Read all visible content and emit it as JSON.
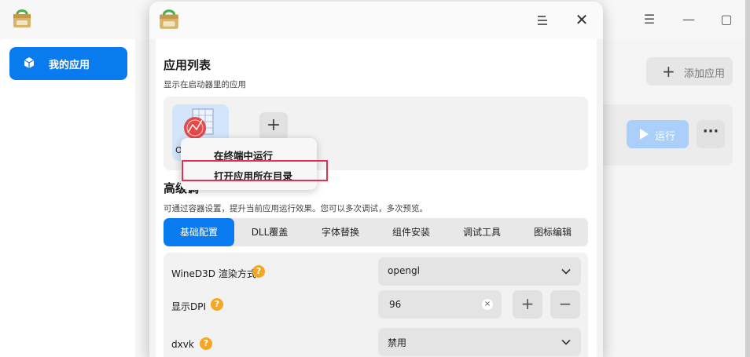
{
  "main_window": {
    "sidebar": {
      "items": [
        {
          "label": "我的应用",
          "icon": "cube-icon",
          "active": true
        }
      ]
    },
    "toolbar": {
      "add_app_label": "添加应用"
    },
    "app_card": {
      "run_label": "运行",
      "more_label": "···"
    }
  },
  "dialog": {
    "apps_section": {
      "title": "应用列表",
      "subtitle": "显示在启动器里的应用",
      "apps": [
        {
          "name": "Orig"
        }
      ]
    },
    "context_menu": {
      "items": [
        "在终端中运行",
        "打开应用所在目录"
      ]
    },
    "advanced_section": {
      "title": "高级调",
      "subtitle": "可通过容器设置，提升当前应用运行效果。您可以多次调试，多次预览。"
    },
    "tabs": [
      "基础配置",
      "DLL覆盖",
      "字体替换",
      "组件安装",
      "调试工具",
      "图标编辑"
    ],
    "form": {
      "renderer": {
        "label": "WineD3D 渲染方式",
        "value": "opengl"
      },
      "dpi": {
        "label": "显示DPI",
        "value": "96"
      },
      "dxvk": {
        "label": "dxvk",
        "value": "禁用"
      },
      "help_glyph": "?"
    }
  },
  "colors": {
    "accent": "#0a7bef",
    "highlight_border": "#e3304c",
    "help_badge": "#f5a623"
  }
}
